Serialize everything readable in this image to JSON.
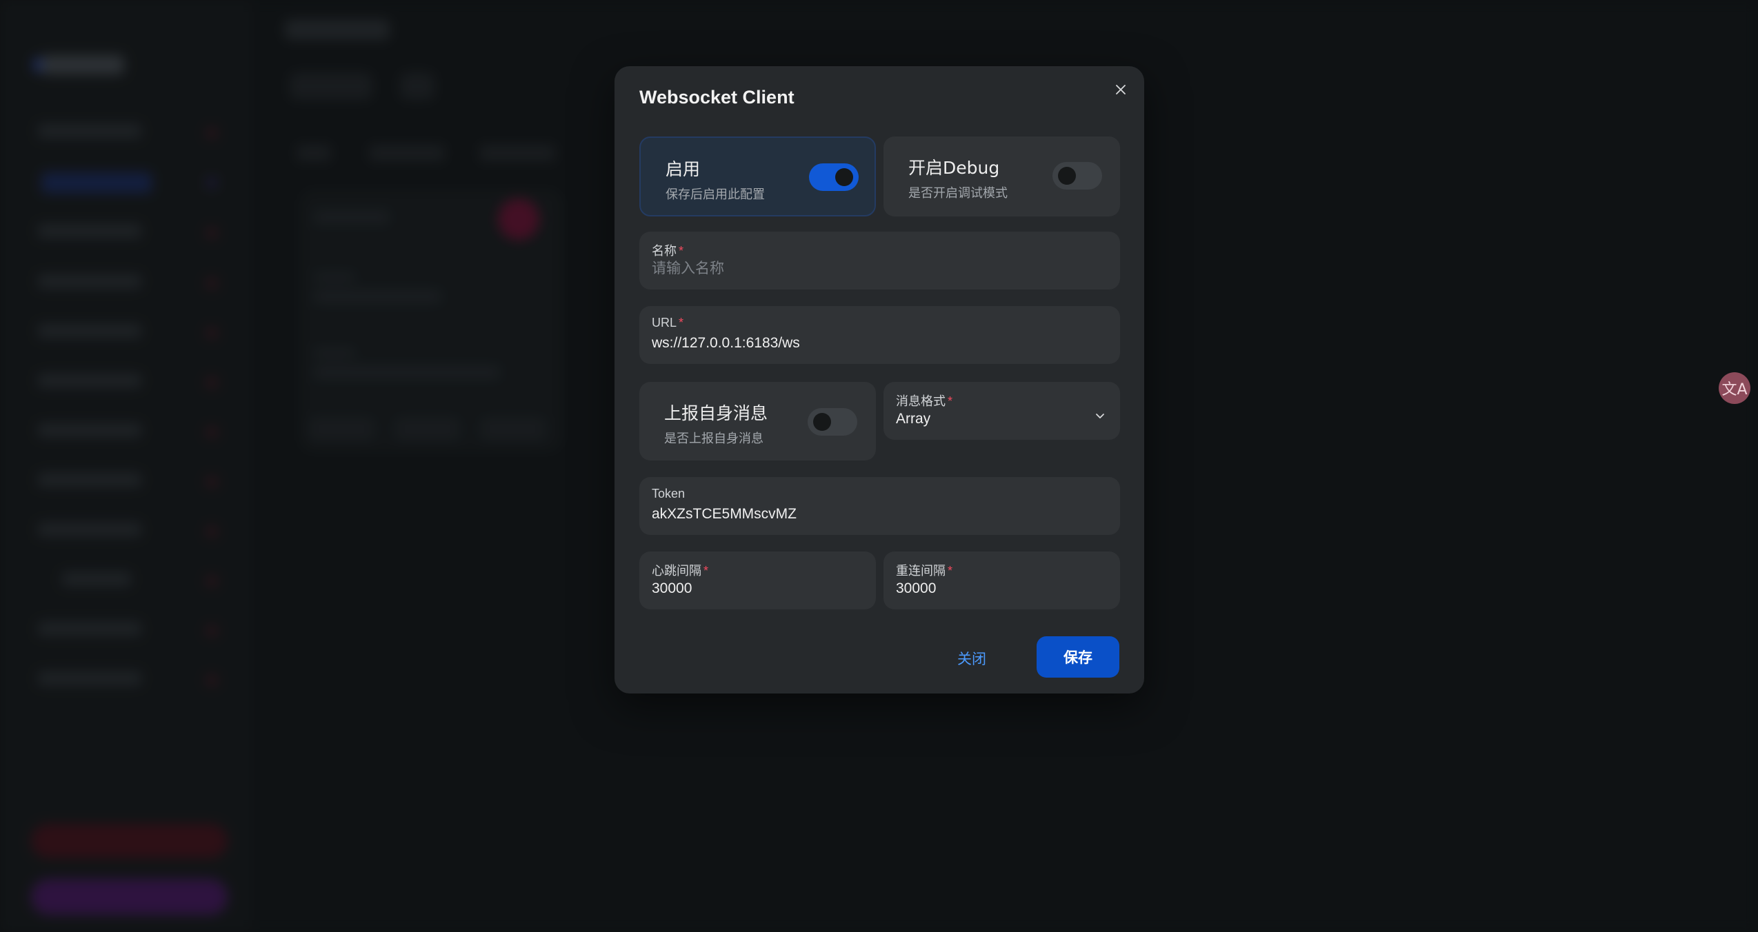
{
  "modal": {
    "title": "Websocket Client",
    "close_icon": "close-icon"
  },
  "enable": {
    "title": "启用",
    "description": "保存后启用此配置",
    "on": true
  },
  "debug": {
    "title": "开启Debug",
    "description": "是否开启调试模式",
    "on": false
  },
  "name_field": {
    "label": "名称",
    "required_mark": "*",
    "placeholder": "请输入名称",
    "value": ""
  },
  "url_field": {
    "label": "URL",
    "required_mark": "*",
    "value": "ws://127.0.0.1:6183/ws"
  },
  "report_self": {
    "title": "上报自身消息",
    "description": "是否上报自身消息",
    "on": false
  },
  "message_format": {
    "label": "消息格式",
    "required_mark": "*",
    "value": "Array",
    "icon": "chevron-down-icon"
  },
  "token_field": {
    "label": "Token",
    "value": "akXZsTCE5MMscvMZ"
  },
  "heartbeat_field": {
    "label": "心跳间隔",
    "required_mark": "*",
    "value": "30000"
  },
  "reconnect_field": {
    "label": "重连间隔",
    "required_mark": "*",
    "value": "30000"
  },
  "actions": {
    "close_label": "关闭",
    "save_label": "保存"
  },
  "translate": {
    "glyph": "文A",
    "icon": "translate-icon"
  },
  "colors": {
    "accent": "#0a50c8",
    "link": "#4c9bff",
    "required": "#f04a5e",
    "modal_bg": "#26292c"
  }
}
